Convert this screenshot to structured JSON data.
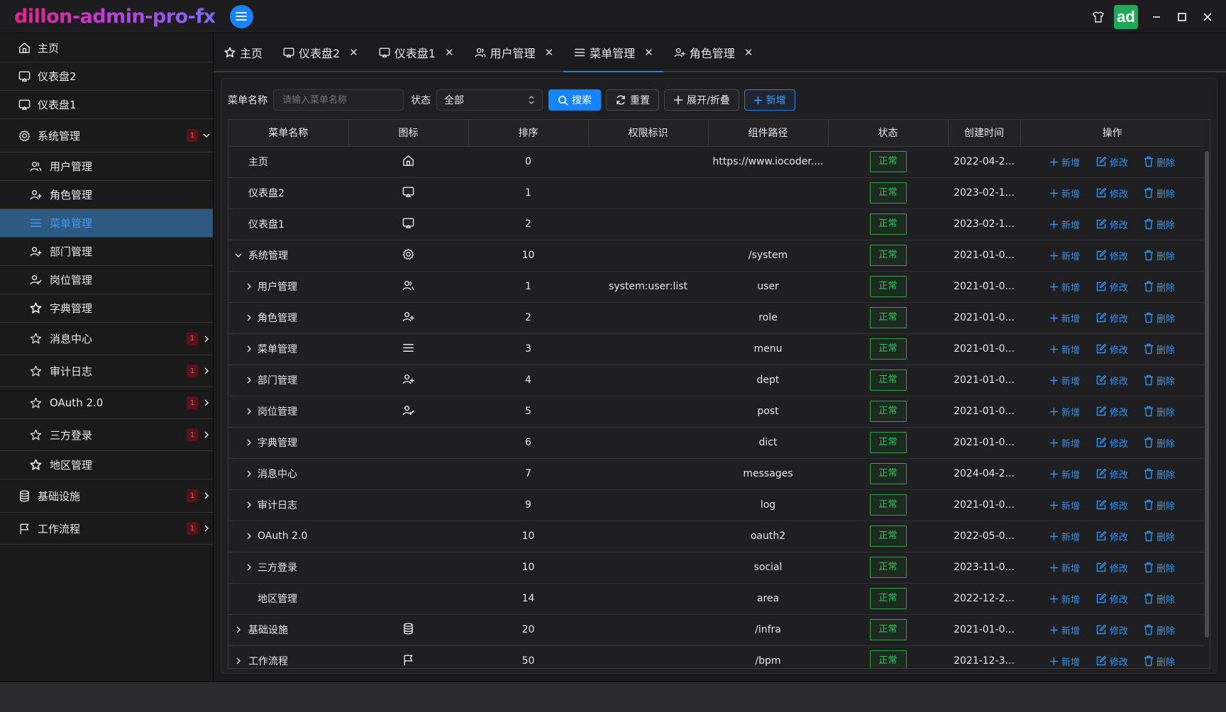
{
  "app": {
    "title": "dillon-admin-pro-fx",
    "avatar_text": "ad"
  },
  "window_controls": [
    "shirt-icon",
    "minimize-icon",
    "maximize-icon",
    "close-icon"
  ],
  "sidebar": {
    "items": [
      {
        "label": "主页",
        "icon": "home-icon",
        "level": 0
      },
      {
        "label": "仪表盘2",
        "icon": "screen-icon",
        "level": 0
      },
      {
        "label": "仪表盘1",
        "icon": "screen-icon",
        "level": 0
      },
      {
        "label": "系统管理",
        "icon": "gear-icon",
        "level": 0,
        "badge": "1",
        "expanded": true
      },
      {
        "label": "用户管理",
        "icon": "users-icon",
        "level": 1
      },
      {
        "label": "角色管理",
        "icon": "user-plus-icon",
        "level": 1
      },
      {
        "label": "菜单管理",
        "icon": "menu-icon",
        "level": 1,
        "active": true
      },
      {
        "label": "部门管理",
        "icon": "user-plus-icon",
        "level": 1
      },
      {
        "label": "岗位管理",
        "icon": "user-check-icon",
        "level": 1
      },
      {
        "label": "字典管理",
        "icon": "star-icon",
        "level": 1
      },
      {
        "label": "消息中心",
        "icon": "star-outline-icon",
        "level": 1,
        "badge": "1"
      },
      {
        "label": "审计日志",
        "icon": "star-outline-icon",
        "level": 1,
        "badge": "1"
      },
      {
        "label": "OAuth 2.0",
        "icon": "star-outline-icon",
        "level": 1,
        "badge": "1"
      },
      {
        "label": "三方登录",
        "icon": "star-outline-icon",
        "level": 1,
        "badge": "1"
      },
      {
        "label": "地区管理",
        "icon": "star-icon",
        "level": 1
      },
      {
        "label": "基础设施",
        "icon": "database-icon",
        "level": 0,
        "badge": "1"
      },
      {
        "label": "工作流程",
        "icon": "flag-icon",
        "level": 0,
        "badge": "1"
      }
    ]
  },
  "tabs": [
    {
      "label": "主页",
      "icon": "star-icon",
      "closable": false
    },
    {
      "label": "仪表盘2",
      "icon": "screen-icon",
      "closable": true
    },
    {
      "label": "仪表盘1",
      "icon": "screen-icon",
      "closable": true
    },
    {
      "label": "用户管理",
      "icon": "users-icon",
      "closable": true
    },
    {
      "label": "菜单管理",
      "icon": "menu-icon",
      "closable": true,
      "active": true
    },
    {
      "label": "角色管理",
      "icon": "user-plus-icon",
      "closable": true
    }
  ],
  "search": {
    "name_label": "菜单名称",
    "name_placeholder": "请输入菜单名称",
    "status_label": "状态",
    "status_value": "全部",
    "search_button": "搜索",
    "reset_button": "重置",
    "toggle_button": "展开/折叠",
    "add_button": "新增"
  },
  "table": {
    "columns": [
      "菜单名称",
      "图标",
      "排序",
      "权限标识",
      "组件路径",
      "状态",
      "创建时间",
      "操作"
    ],
    "op_labels": {
      "add": "新增",
      "edit": "修改",
      "delete": "删除"
    },
    "rows": [
      {
        "name": "主页",
        "level": 0,
        "tree": "none",
        "icon": "home-icon",
        "sort": "0",
        "perm": "",
        "path": "https://www.iocoder....",
        "status": "正常",
        "created": "2022-04-2..."
      },
      {
        "name": "仪表盘2",
        "level": 0,
        "tree": "none",
        "icon": "screen-icon",
        "sort": "1",
        "perm": "",
        "path": "",
        "status": "正常",
        "created": "2023-02-1..."
      },
      {
        "name": "仪表盘1",
        "level": 0,
        "tree": "none",
        "icon": "screen-icon",
        "sort": "2",
        "perm": "",
        "path": "",
        "status": "正常",
        "created": "2023-02-1..."
      },
      {
        "name": "系统管理",
        "level": 0,
        "tree": "expanded",
        "icon": "gear-icon",
        "sort": "10",
        "perm": "",
        "path": "/system",
        "status": "正常",
        "created": "2021-01-0..."
      },
      {
        "name": "用户管理",
        "level": 1,
        "tree": "collapsed",
        "icon": "users-icon",
        "sort": "1",
        "perm": "system:user:list",
        "path": "user",
        "status": "正常",
        "created": "2021-01-0..."
      },
      {
        "name": "角色管理",
        "level": 1,
        "tree": "collapsed",
        "icon": "user-plus-icon",
        "sort": "2",
        "perm": "",
        "path": "role",
        "status": "正常",
        "created": "2021-01-0..."
      },
      {
        "name": "菜单管理",
        "level": 1,
        "tree": "collapsed",
        "icon": "menu-icon",
        "sort": "3",
        "perm": "",
        "path": "menu",
        "status": "正常",
        "created": "2021-01-0..."
      },
      {
        "name": "部门管理",
        "level": 1,
        "tree": "collapsed",
        "icon": "user-plus-icon",
        "sort": "4",
        "perm": "",
        "path": "dept",
        "status": "正常",
        "created": "2021-01-0..."
      },
      {
        "name": "岗位管理",
        "level": 1,
        "tree": "collapsed",
        "icon": "user-check-icon",
        "sort": "5",
        "perm": "",
        "path": "post",
        "status": "正常",
        "created": "2021-01-0..."
      },
      {
        "name": "字典管理",
        "level": 1,
        "tree": "collapsed",
        "icon": "",
        "sort": "6",
        "perm": "",
        "path": "dict",
        "status": "正常",
        "created": "2021-01-0..."
      },
      {
        "name": "消息中心",
        "level": 1,
        "tree": "collapsed",
        "icon": "",
        "sort": "7",
        "perm": "",
        "path": "messages",
        "status": "正常",
        "created": "2024-04-2..."
      },
      {
        "name": "审计日志",
        "level": 1,
        "tree": "collapsed",
        "icon": "",
        "sort": "9",
        "perm": "",
        "path": "log",
        "status": "正常",
        "created": "2021-01-0..."
      },
      {
        "name": "OAuth 2.0",
        "level": 1,
        "tree": "collapsed",
        "icon": "",
        "sort": "10",
        "perm": "",
        "path": "oauth2",
        "status": "正常",
        "created": "2022-05-0..."
      },
      {
        "name": "三方登录",
        "level": 1,
        "tree": "collapsed",
        "icon": "",
        "sort": "10",
        "perm": "",
        "path": "social",
        "status": "正常",
        "created": "2023-11-0..."
      },
      {
        "name": "地区管理",
        "level": 1,
        "tree": "none",
        "icon": "",
        "sort": "14",
        "perm": "",
        "path": "area",
        "status": "正常",
        "created": "2022-12-2..."
      },
      {
        "name": "基础设施",
        "level": 0,
        "tree": "collapsed",
        "icon": "database-icon",
        "sort": "20",
        "perm": "",
        "path": "/infra",
        "status": "正常",
        "created": "2021-01-0..."
      },
      {
        "name": "工作流程",
        "level": 0,
        "tree": "collapsed",
        "icon": "flag-icon",
        "sort": "50",
        "perm": "",
        "path": "/bpm",
        "status": "正常",
        "created": "2021-12-3..."
      }
    ]
  },
  "colors": {
    "accent": "#1684fc",
    "status_green": "#2ec85a",
    "badge_red": "#e05a5a",
    "sidebar_active_bg": "#2e5a82"
  }
}
